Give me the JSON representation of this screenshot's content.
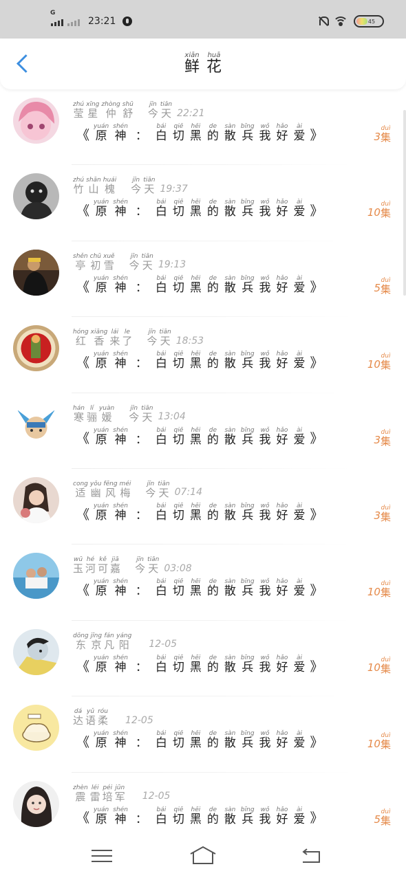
{
  "status_bar": {
    "time": "23:21",
    "network": "G",
    "battery": "45"
  },
  "header": {
    "title_chars": [
      {
        "c": "鲜",
        "p": "xiān"
      },
      {
        "c": "花",
        "p": "huā"
      }
    ]
  },
  "message_text": [
    {
      "c": "原",
      "p": "yuán"
    },
    {
      "c": "神",
      "p": "shén"
    },
    {
      "sep": "："
    },
    {
      "c": "白",
      "p": "bái"
    },
    {
      "c": "切",
      "p": "qiē"
    },
    {
      "c": "黑",
      "p": "hēi"
    },
    {
      "c": "的",
      "p": "de"
    },
    {
      "c": "散",
      "p": "sàn"
    },
    {
      "c": "兵",
      "p": "bīng"
    },
    {
      "c": "我",
      "p": "wǒ"
    },
    {
      "c": "好",
      "p": "hǎo"
    },
    {
      "c": "爱",
      "p": "ài"
    }
  ],
  "brackets": {
    "open": "《",
    "close": "》"
  },
  "count_unit": {
    "c": "集",
    "p": "duì"
  },
  "rows": [
    {
      "name": [
        {
          "c": "莹",
          "p": "zhú"
        },
        {
          "c": "星",
          "p": "xīng"
        },
        {
          "c": "仲",
          "p": "zhòng"
        },
        {
          "c": "舒",
          "p": "shū"
        }
      ],
      "day": {
        "chars": [
          {
            "c": "今",
            "p": "jīn"
          },
          {
            "c": "天",
            "p": "tiān"
          }
        ],
        "time": "22:21"
      },
      "count": "3"
    },
    {
      "name": [
        {
          "c": "竹",
          "p": "zhú"
        },
        {
          "c": "山",
          "p": "shān"
        },
        {
          "c": "槐",
          "p": "huái"
        }
      ],
      "day": {
        "chars": [
          {
            "c": "今",
            "p": "jīn"
          },
          {
            "c": "天",
            "p": "tiān"
          }
        ],
        "time": "19:37"
      },
      "count": "10"
    },
    {
      "name": [
        {
          "c": "亭",
          "p": "shěn"
        },
        {
          "c": "初",
          "p": "chū"
        },
        {
          "c": "雪",
          "p": "xuě"
        }
      ],
      "day": {
        "chars": [
          {
            "c": "今",
            "p": "jīn"
          },
          {
            "c": "天",
            "p": "tiān"
          }
        ],
        "time": "19:13"
      },
      "count": "5"
    },
    {
      "name": [
        {
          "c": "红",
          "p": "hóng"
        },
        {
          "c": "香",
          "p": "xiāng"
        },
        {
          "c": "来",
          "p": "lái"
        },
        {
          "c": "了",
          "p": "le"
        }
      ],
      "day": {
        "chars": [
          {
            "c": "今",
            "p": "jīn"
          },
          {
            "c": "天",
            "p": "tiān"
          }
        ],
        "time": "18:53"
      },
      "count": "10"
    },
    {
      "name": [
        {
          "c": "寒",
          "p": "hán"
        },
        {
          "c": "骊",
          "p": "lí"
        },
        {
          "c": "媛",
          "p": "yuàn"
        }
      ],
      "day": {
        "chars": [
          {
            "c": "今",
            "p": "jīn"
          },
          {
            "c": "天",
            "p": "tiān"
          }
        ],
        "time": "13:04"
      },
      "count": "3"
    },
    {
      "name": [
        {
          "c": "适",
          "p": "cong"
        },
        {
          "c": "幽",
          "p": "yōu"
        },
        {
          "c": "风",
          "p": "fēng"
        },
        {
          "c": "梅",
          "p": "méi"
        }
      ],
      "day": {
        "chars": [
          {
            "c": "今",
            "p": "jīn"
          },
          {
            "c": "天",
            "p": "tiān"
          }
        ],
        "time": "07:14"
      },
      "count": "3"
    },
    {
      "name": [
        {
          "c": "玉",
          "p": "wū"
        },
        {
          "c": "河",
          "p": "hé"
        },
        {
          "c": "可",
          "p": "kě"
        },
        {
          "c": "嘉",
          "p": "jiā"
        }
      ],
      "day": {
        "chars": [
          {
            "c": "今",
            "p": "jīn"
          },
          {
            "c": "天",
            "p": "tiān"
          }
        ],
        "time": "03:08"
      },
      "count": "10"
    },
    {
      "name": [
        {
          "c": "东",
          "p": "dōng"
        },
        {
          "c": "京",
          "p": "jīng"
        },
        {
          "c": "凡",
          "p": "fán"
        },
        {
          "c": "阳",
          "p": "yáng"
        }
      ],
      "day": {
        "chars": [],
        "time": "12-05"
      },
      "count": "10"
    },
    {
      "name": [
        {
          "c": "达",
          "p": "dá"
        },
        {
          "c": "语",
          "p": "yǔ"
        },
        {
          "c": "柔",
          "p": "róu"
        }
      ],
      "day": {
        "chars": [],
        "time": "12-05"
      },
      "count": "10"
    },
    {
      "name": [
        {
          "c": "震",
          "p": "zhèn"
        },
        {
          "c": "雷",
          "p": "léi"
        },
        {
          "c": "培",
          "p": "péi"
        },
        {
          "c": "军",
          "p": "jūn"
        }
      ],
      "day": {
        "chars": [],
        "time": "12-05"
      },
      "count": "5"
    }
  ],
  "nav": {
    "menu": "menu-icon",
    "home": "home-icon",
    "back": "back-icon"
  },
  "colors": {
    "accent": "#e58a4a",
    "back_arrow": "#3d8fe0"
  }
}
